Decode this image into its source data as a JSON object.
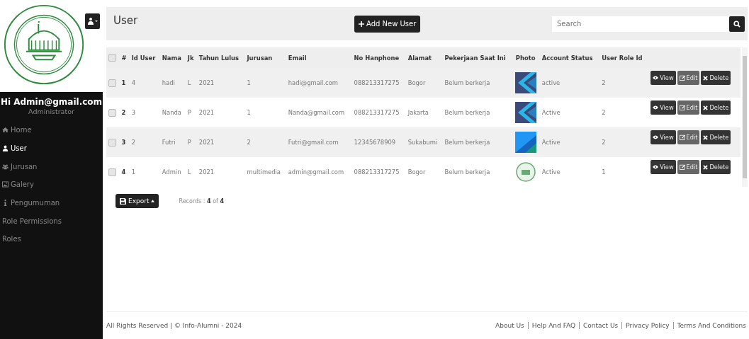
{
  "sidebar": {
    "greeting": "Hi Admin@gmail.com",
    "role": "Administrator",
    "items": [
      {
        "label": "Home",
        "selected": false
      },
      {
        "label": "User",
        "selected": true
      },
      {
        "label": "Jurusan",
        "selected": false
      },
      {
        "label": "Galery",
        "selected": false
      },
      {
        "label": "Pengumuman",
        "selected": false
      },
      {
        "label": "Role Permissions",
        "selected": false
      },
      {
        "label": "Roles",
        "selected": false
      }
    ]
  },
  "header": {
    "title": "User",
    "add_button": "Add New User",
    "search": {
      "placeholder": "Search"
    }
  },
  "table": {
    "select_all_checked": false,
    "columns": [
      "#",
      "Id User",
      "Nama",
      "Jk",
      "Tahun Lulus",
      "Jurusan",
      "Email",
      "No Hanphone",
      "Alamat",
      "Pekerjaan Saat Ini",
      "Photo",
      "Account Status",
      "User Role Id"
    ],
    "rows": [
      {
        "checked": false,
        "no": "1",
        "id": "4",
        "nama": "hadi",
        "jk": "L",
        "tahun": "2021",
        "jurusan": "1",
        "email": "hadi@gmail.com",
        "hp": "088213317275",
        "alamat": "Bogor",
        "pekerjaan": "Belum berkerja",
        "status": "active",
        "role": "2",
        "actions": [
          "View",
          "Edit",
          "Delete"
        ]
      },
      {
        "checked": false,
        "no": "2",
        "id": "3",
        "nama": "Nanda",
        "jk": "P",
        "tahun": "2021",
        "jurusan": "1",
        "email": "Nanda@gmail.com",
        "hp": "088213317275",
        "alamat": "Jakarta",
        "pekerjaan": "Belum berkerja",
        "status": "Active",
        "role": "2",
        "actions": [
          "View",
          "Edit",
          "Delete"
        ]
      },
      {
        "checked": false,
        "no": "3",
        "id": "2",
        "nama": "Futri",
        "jk": "P",
        "tahun": "2021",
        "jurusan": "2",
        "email": "Futri@gmail.com",
        "hp": "12345678909",
        "alamat": "Sukabumi",
        "pekerjaan": "Belum berkerja",
        "status": "Active",
        "role": "2",
        "actions": [
          "View",
          "Edit",
          "Delete"
        ]
      },
      {
        "checked": false,
        "no": "4",
        "id": "1",
        "nama": "Admin",
        "jk": "L",
        "tahun": "2021",
        "jurusan": "multimedia",
        "email": "admin@gmail.com",
        "hp": "088213317275",
        "alamat": "Bogor",
        "pekerjaan": "Belum berkerja",
        "status": "Active",
        "role": "1",
        "actions": [
          "View",
          "Edit",
          "Delete"
        ]
      }
    ]
  },
  "export_button": "Export",
  "records": {
    "label": "Records :",
    "shown": "4",
    "of": "of",
    "total": "4"
  },
  "footer": {
    "copyright": "All Rights Reserved | © Info-Alumni - 2024",
    "links": [
      "About Us",
      "Help And FAQ",
      "Contact Us",
      "Privacy Policy",
      "Terms And Conditions"
    ]
  }
}
